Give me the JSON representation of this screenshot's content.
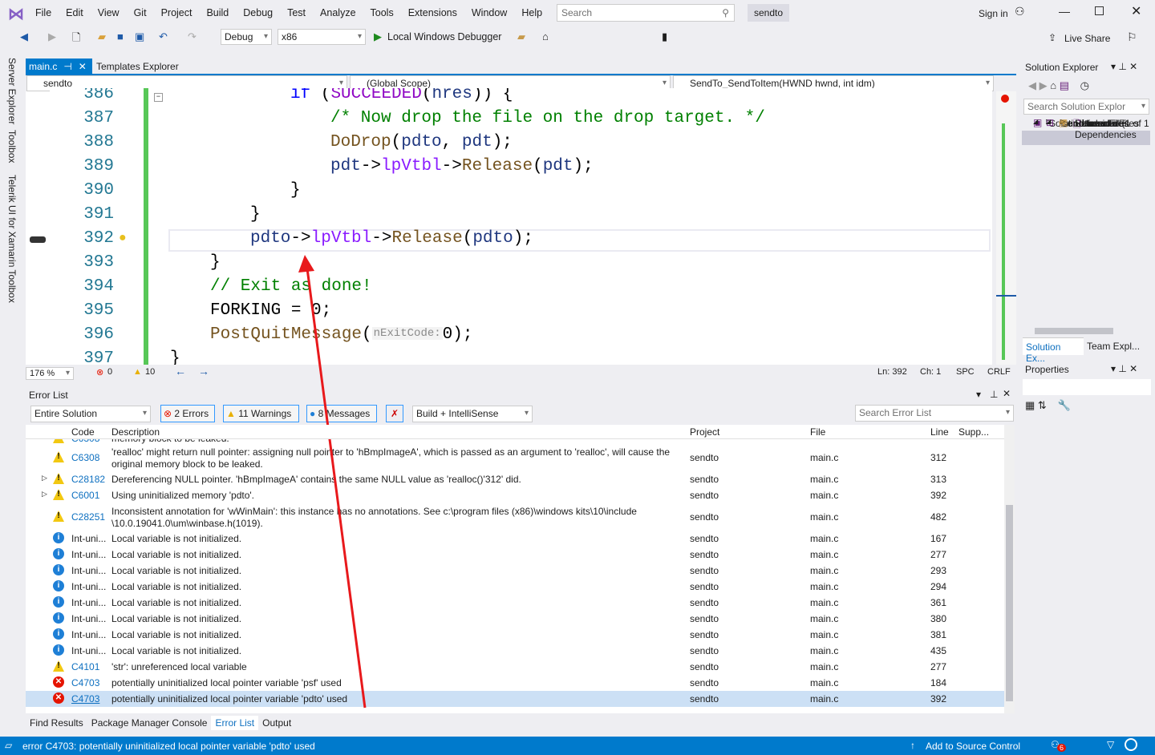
{
  "menu": [
    "File",
    "Edit",
    "View",
    "Git",
    "Project",
    "Build",
    "Debug",
    "Test",
    "Analyze",
    "Tools",
    "Extensions",
    "Window",
    "Help"
  ],
  "search_placeholder": "Search",
  "solution_name": "sendto",
  "sign_in": "Sign in",
  "live_share": "Live Share",
  "toolbar": {
    "config": "Debug",
    "platform": "x86",
    "run": "Local Windows Debugger"
  },
  "side_tabs": [
    "Server Explorer",
    "Toolbox",
    "Telerik UI for Xamarin Toolbox"
  ],
  "tabs": [
    {
      "label": "main.c"
    },
    {
      "label": "Templates Explorer"
    }
  ],
  "nav": {
    "project": "sendto",
    "scope": "(Global Scope)",
    "member": "SendTo_SendToItem(HWND hwnd, int idm)"
  },
  "code_lines": [
    {
      "n": "386",
      "text": "if (SUCCEEDED(hres)) {"
    },
    {
      "n": "387",
      "text": "/* Now drop the file on the drop target. */"
    },
    {
      "n": "388",
      "text": "DoDrop(pdto, pdt);"
    },
    {
      "n": "389",
      "text": "pdt->lpVtbl->Release(pdt);"
    },
    {
      "n": "390",
      "text": "}"
    },
    {
      "n": "391",
      "text": "}"
    },
    {
      "n": "392",
      "text": "pdto->lpVtbl->Release(pdto);"
    },
    {
      "n": "393",
      "text": "}"
    },
    {
      "n": "394",
      "text": "// Exit as done!"
    },
    {
      "n": "395",
      "text": "FORKING = 0;"
    },
    {
      "n": "396",
      "text": "PostQuitMessage(",
      "hint": "nExitCode:",
      "rest": "0);"
    },
    {
      "n": "397",
      "text": "}"
    }
  ],
  "editor_status": {
    "zoom": "176 %",
    "errors": "0",
    "warnings": "10",
    "ln": "Ln: 392",
    "ch": "Ch: 1",
    "spc": "SPC",
    "crlf": "CRLF"
  },
  "error_list": {
    "title": "Error List",
    "scope": "Entire Solution",
    "errors": "2 Errors",
    "warnings": "11 Warnings",
    "messages": "8 Messages",
    "source": "Build + IntelliSense",
    "search_placeholder": "Search Error List",
    "columns": [
      "Code",
      "Description",
      "Project",
      "File",
      "Line",
      "Supp..."
    ],
    "rows": [
      {
        "type": "warning",
        "code": "C6308",
        "desc": "memory block to be leaked.",
        "project": "",
        "file": "",
        "line": "",
        "partial": true
      },
      {
        "type": "warning",
        "code": "C6308",
        "desc": "'realloc' might return null pointer: assigning null pointer to 'hBmpImageA', which is passed as an argument to 'realloc', will cause the",
        "desc2": "original memory block to be leaked.",
        "project": "sendto",
        "file": "main.c",
        "line": "312"
      },
      {
        "type": "warning",
        "code": "C28182",
        "desc": "Dereferencing NULL pointer. 'hBmpImageA' contains the same NULL value as 'realloc()'312' did.",
        "project": "sendto",
        "file": "main.c",
        "line": "313",
        "expand": true
      },
      {
        "type": "warning",
        "code": "C6001",
        "desc": "Using uninitialized memory 'pdto'.",
        "project": "sendto",
        "file": "main.c",
        "line": "392",
        "expand": true
      },
      {
        "type": "warning",
        "code": "C28251",
        "desc": "Inconsistent annotation for 'wWinMain': this instance has no annotations. See c:\\program files (x86)\\windows kits\\10\\include",
        "desc2": "\\10.0.19041.0\\um\\winbase.h(1019).",
        "project": "sendto",
        "file": "main.c",
        "line": "482"
      },
      {
        "type": "info",
        "code": "Int-uni...",
        "desc": "Local variable is not initialized.",
        "project": "sendto",
        "file": "main.c",
        "line": "167"
      },
      {
        "type": "info",
        "code": "Int-uni...",
        "desc": "Local variable is not initialized.",
        "project": "sendto",
        "file": "main.c",
        "line": "277"
      },
      {
        "type": "info",
        "code": "Int-uni...",
        "desc": "Local variable is not initialized.",
        "project": "sendto",
        "file": "main.c",
        "line": "293"
      },
      {
        "type": "info",
        "code": "Int-uni...",
        "desc": "Local variable is not initialized.",
        "project": "sendto",
        "file": "main.c",
        "line": "294"
      },
      {
        "type": "info",
        "code": "Int-uni...",
        "desc": "Local variable is not initialized.",
        "project": "sendto",
        "file": "main.c",
        "line": "361"
      },
      {
        "type": "info",
        "code": "Int-uni...",
        "desc": "Local variable is not initialized.",
        "project": "sendto",
        "file": "main.c",
        "line": "380"
      },
      {
        "type": "info",
        "code": "Int-uni...",
        "desc": "Local variable is not initialized.",
        "project": "sendto",
        "file": "main.c",
        "line": "381"
      },
      {
        "type": "info",
        "code": "Int-uni...",
        "desc": "Local variable is not initialized.",
        "project": "sendto",
        "file": "main.c",
        "line": "435"
      },
      {
        "type": "warning",
        "code": "C4101",
        "desc": "'str': unreferenced local variable",
        "project": "sendto",
        "file": "main.c",
        "line": "277"
      },
      {
        "type": "error",
        "code": "C4703",
        "desc": "potentially uninitialized local pointer variable 'psf' used",
        "project": "sendto",
        "file": "main.c",
        "line": "184"
      },
      {
        "type": "error",
        "code": "C4703",
        "desc": "potentially uninitialized local pointer variable 'pdto' used",
        "project": "sendto",
        "file": "main.c",
        "line": "392",
        "selected": true
      }
    ]
  },
  "bottom_tabs": [
    "Find Results",
    "Package Manager Console",
    "Error List",
    "Output"
  ],
  "solution_explorer": {
    "title": "Solution Explorer",
    "search_placeholder": "Search Solution Explor",
    "items": [
      {
        "label": "Solution 'sendto' (1 of 1",
        "level": 0
      },
      {
        "label": "sendto",
        "level": 1,
        "bold": true
      },
      {
        "label": "References",
        "level": 2
      },
      {
        "label": "External Dependencies",
        "level": 2
      },
      {
        "label": "Header Files",
        "level": 2
      },
      {
        "label": "Resource Files",
        "level": 2
      },
      {
        "label": "Source Files",
        "level": 2
      },
      {
        "label": "main.c",
        "level": 3
      }
    ],
    "tabs": [
      "Solution Ex...",
      "Team Expl..."
    ]
  },
  "properties": {
    "title": "Properties"
  },
  "status_bar": {
    "message": "error C4703: potentially uninitialized local pointer variable 'pdto' used",
    "source_control": "Add to Source Control",
    "notifications": "6"
  },
  "colors": {
    "accent": "#007acc",
    "vs_purple": "#68217a",
    "annotation_arrow": "#e8191c"
  }
}
